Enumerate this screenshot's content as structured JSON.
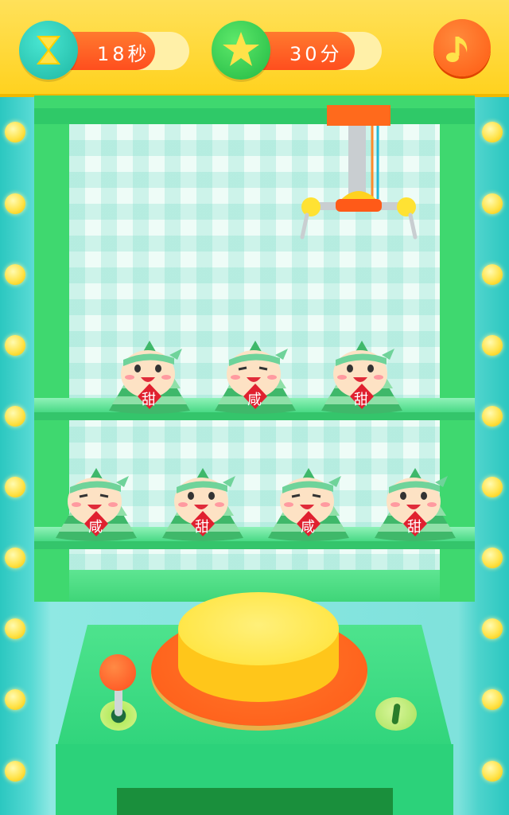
{
  "hud": {
    "timer_text": "18秒",
    "timer_fraction": 0.76,
    "score_text": "30分",
    "score_fraction": 0.81
  },
  "icons": {
    "timer": "hourglass-icon",
    "score": "star-icon",
    "music": "music-note-icon"
  },
  "colors": {
    "topbar": "#ffd21f",
    "accent_orange": "#ff5a12",
    "cabinet_green": "#3fd86f",
    "button_yellow": "#ffe233"
  },
  "shelves": {
    "upper": [
      {
        "flavor": "甜"
      },
      {
        "flavor": "咸"
      },
      {
        "flavor": "甜"
      }
    ],
    "lower": [
      {
        "flavor": "咸"
      },
      {
        "flavor": "甜"
      },
      {
        "flavor": "咸"
      },
      {
        "flavor": "甜"
      }
    ]
  }
}
